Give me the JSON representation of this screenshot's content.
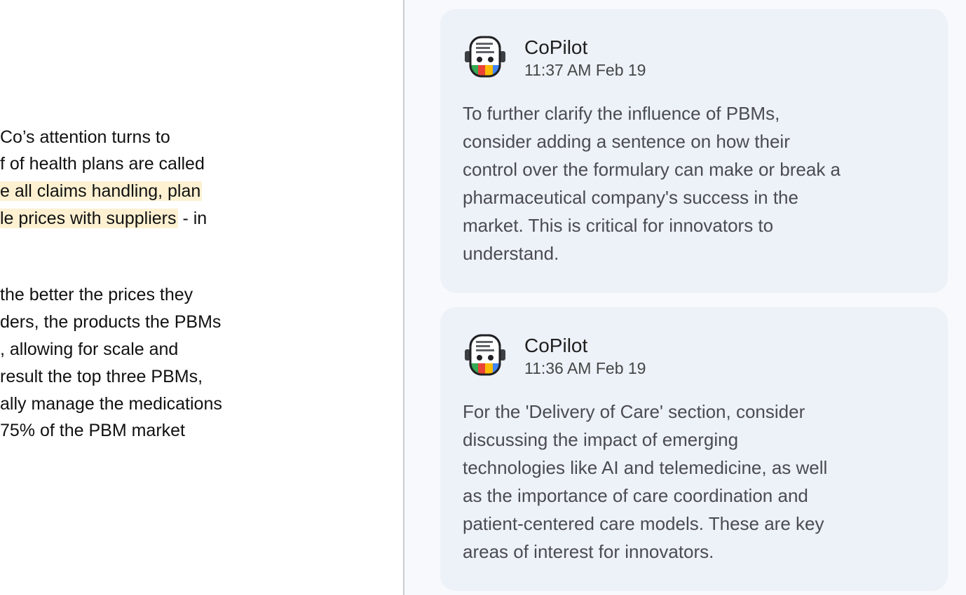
{
  "document": {
    "lines": [
      {
        "text": "Co’s attention turns to",
        "highlight": false
      },
      {
        "text": "f of health plans are called",
        "highlight": false
      },
      {
        "text": "e all claims handling, plan",
        "highlight": true
      },
      {
        "text": "le prices with suppliers",
        "highlight": true,
        "suffix": " - in"
      },
      {
        "text": "the better the prices they",
        "highlight": false
      },
      {
        "text": "ders, the products the PBMs",
        "highlight": false
      },
      {
        "text": ", allowing for scale and",
        "highlight": false
      },
      {
        "text": "result the top three PBMs,",
        "highlight": false
      },
      {
        "text": "ally manage the medications",
        "highlight": false
      },
      {
        "text": "75% of the PBM market",
        "highlight": false
      }
    ]
  },
  "comments": [
    {
      "author": "CoPilot",
      "timestamp": "11:37 AM Feb 19",
      "avatar_icon": "copilot-robot-icon",
      "lines": [
        "To further clarify the influence of PBMs,",
        "consider adding a sentence on how their",
        "control over the formulary can make or break a",
        "pharmaceutical company's success in the",
        "market. This is critical for innovators to",
        "understand."
      ]
    },
    {
      "author": "CoPilot",
      "timestamp": "11:36 AM Feb 19",
      "avatar_icon": "copilot-robot-icon",
      "lines": [
        "For the 'Delivery of Care' section, consider",
        "discussing the impact of emerging",
        "technologies like AI and telemedicine, as well",
        "as the importance of care coordination and",
        "patient-centered care models. These are key",
        "areas of interest for innovators."
      ]
    }
  ],
  "colors": {
    "highlight": "#fdf1d2",
    "card_background": "#edf1f8",
    "panel_background": "#f8f9fc"
  }
}
